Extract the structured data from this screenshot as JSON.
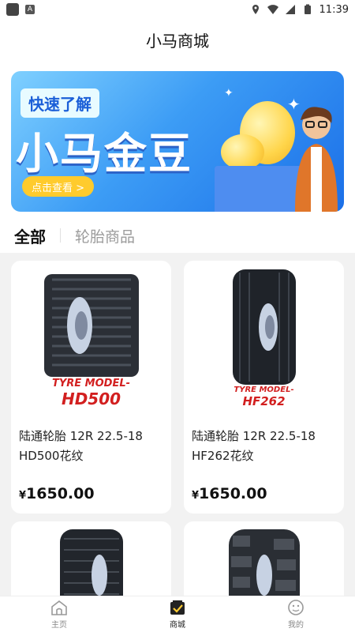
{
  "status_bar": {
    "time": "11:39",
    "app_badge": "A"
  },
  "header": {
    "title": "小马商城"
  },
  "banner": {
    "tag": "快速了解",
    "headline": "小马金豆",
    "cta": "点击查看 >",
    "colors": {
      "gold": "#ffd54a",
      "blue": "#1b6fe8",
      "cta": "#ffcb2d"
    }
  },
  "tabs": [
    {
      "label": "全部",
      "active": true
    },
    {
      "label": "轮胎商品",
      "active": false
    }
  ],
  "products": [
    {
      "title": "陆通轮胎 12R 22.5-18 HD500花纹",
      "currency": "¥",
      "price": "1650.00",
      "model_line1": "TYRE MODEL-",
      "model_line2": "HD500"
    },
    {
      "title": "陆通轮胎 12R 22.5-18 HF262花纹",
      "currency": "¥",
      "price": "1650.00",
      "model_line1": "TYRE MODEL-",
      "model_line2": "HF262"
    },
    {
      "title": "",
      "currency": "",
      "price": ""
    },
    {
      "title": "",
      "currency": "",
      "price": ""
    }
  ],
  "bottom_nav": [
    {
      "label": "主页",
      "icon": "home-icon",
      "active": false
    },
    {
      "label": "商城",
      "icon": "shop-icon",
      "active": true
    },
    {
      "label": "我的",
      "icon": "profile-icon",
      "active": false
    }
  ],
  "accent_color": "#ffcc33"
}
